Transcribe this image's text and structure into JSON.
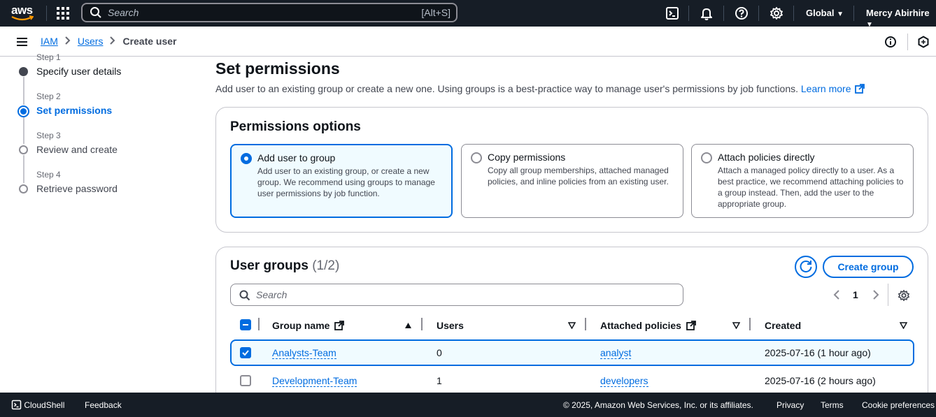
{
  "topbar": {
    "logo_text": "aws",
    "search_placeholder": "Search",
    "search_shortcut": "[Alt+S]",
    "region": "Global",
    "user": "Mercy Abirhire"
  },
  "breadcrumb": {
    "items": [
      "IAM",
      "Users",
      "Create user"
    ]
  },
  "steps": [
    {
      "label": "Step 1",
      "name": "Specify user details",
      "state": "completed"
    },
    {
      "label": "Step 2",
      "name": "Set permissions",
      "state": "current"
    },
    {
      "label": "Step 3",
      "name": "Review and create",
      "state": "pending"
    },
    {
      "label": "Step 4",
      "name": "Retrieve password",
      "state": "pending"
    }
  ],
  "page": {
    "title": "Set permissions",
    "description": "Add user to an existing group or create a new one. Using groups is a best-practice way to manage user's permissions by job functions.",
    "learn_more": "Learn more"
  },
  "permissions_options": {
    "title": "Permissions options",
    "options": [
      {
        "title": "Add user to group",
        "desc": "Add user to an existing group, or create a new group. We recommend using groups to manage user permissions by job function.",
        "selected": true
      },
      {
        "title": "Copy permissions",
        "desc": "Copy all group memberships, attached managed policies, and inline policies from an existing user.",
        "selected": false
      },
      {
        "title": "Attach policies directly",
        "desc": "Attach a managed policy directly to a user. As a best practice, we recommend attaching policies to a group instead. Then, add the user to the appropriate group.",
        "selected": false
      }
    ]
  },
  "user_groups": {
    "title": "User groups",
    "count": "(1/2)",
    "create_button": "Create group",
    "search_placeholder": "Search",
    "page": "1",
    "columns": [
      "Group name",
      "Users",
      "Attached policies",
      "Created"
    ],
    "rows": [
      {
        "name": "Analysts-Team",
        "users": "0",
        "policies": "analyst",
        "created": "2025-07-16 (1 hour ago)",
        "selected": true
      },
      {
        "name": "Development-Team",
        "users": "1",
        "policies": "developers",
        "created": "2025-07-16 (2 hours ago)",
        "selected": false
      }
    ]
  },
  "footer": {
    "cloudshell": "CloudShell",
    "feedback": "Feedback",
    "copyright": "© 2025, Amazon Web Services, Inc. or its affiliates.",
    "privacy": "Privacy",
    "terms": "Terms",
    "cookies": "Cookie preferences"
  },
  "colors": {
    "accent": "#006ce0",
    "topbar": "#161d26",
    "selected_bg": "#f0fbff"
  }
}
